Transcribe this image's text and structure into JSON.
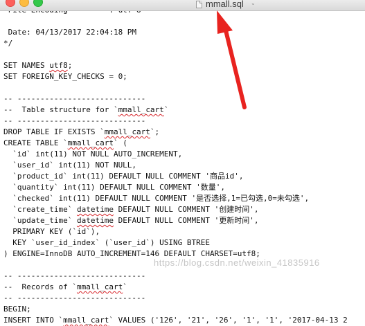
{
  "window": {
    "title": "mmall.sql",
    "title_chevron": "⌄",
    "traffic_lights": [
      "close",
      "minimize",
      "zoom"
    ],
    "colors": {
      "close": "#fc605c",
      "minimize": "#fdbc40",
      "zoom": "#34c84a",
      "annotation_arrow": "#e8231f",
      "spellcheck_underline": "#d8262b"
    }
  },
  "editor": {
    "lines": [
      {
        "text": " File Encoding         : utf-8"
      },
      {
        "text": ""
      },
      {
        "text": " Date: 04/13/2017 22:04:18 PM"
      },
      {
        "text": "*/"
      },
      {
        "text": ""
      },
      {
        "text": "SET NAMES utf8;",
        "squiggle": "utf8"
      },
      {
        "text": "SET FOREIGN_KEY_CHECKS = 0;"
      },
      {
        "text": ""
      },
      {
        "text": "-- ----------------------------"
      },
      {
        "text": "--  Table structure for `mmall_cart`",
        "squiggle": "mmall_cart"
      },
      {
        "text": "-- ----------------------------"
      },
      {
        "text": "DROP TABLE IF EXISTS `mmall_cart`;",
        "squiggle": "mmall_cart"
      },
      {
        "text": "CREATE TABLE `mmall_cart` (",
        "squiggle": "mmall_cart"
      },
      {
        "text": "  `id` int(11) NOT NULL AUTO_INCREMENT,"
      },
      {
        "text": "  `user_id` int(11) NOT NULL,"
      },
      {
        "text": "  `product_id` int(11) DEFAULT NULL COMMENT '商品id',"
      },
      {
        "text": "  `quantity` int(11) DEFAULT NULL COMMENT '数量',"
      },
      {
        "text": "  `checked` int(11) DEFAULT NULL COMMENT '是否选择,1=已勾选,0=未勾选',"
      },
      {
        "text": "  `create_time` datetime DEFAULT NULL COMMENT '创建时间',",
        "squiggle": "datetime"
      },
      {
        "text": "  `update_time` datetime DEFAULT NULL COMMENT '更新时间',",
        "squiggle": "datetime"
      },
      {
        "text": "  PRIMARY KEY (`id`),"
      },
      {
        "text": "  KEY `user_id_index` (`user_id`) USING BTREE"
      },
      {
        "text": ") ENGINE=InnoDB AUTO_INCREMENT=146 DEFAULT CHARSET=utf8;"
      },
      {
        "text": ""
      },
      {
        "text": "-- ----------------------------"
      },
      {
        "text": "--  Records of `mmall_cart`",
        "squiggle": "mmall_cart"
      },
      {
        "text": "-- ----------------------------"
      },
      {
        "text": "BEGIN;"
      },
      {
        "text": "INSERT INTO `mmall_cart` VALUES ('126', '21', '26', '1', '1', '2017-04-13 2",
        "squiggle": "mmall_cart"
      }
    ]
  },
  "watermark": "https://blog.csdn.net/weixin_41835916"
}
